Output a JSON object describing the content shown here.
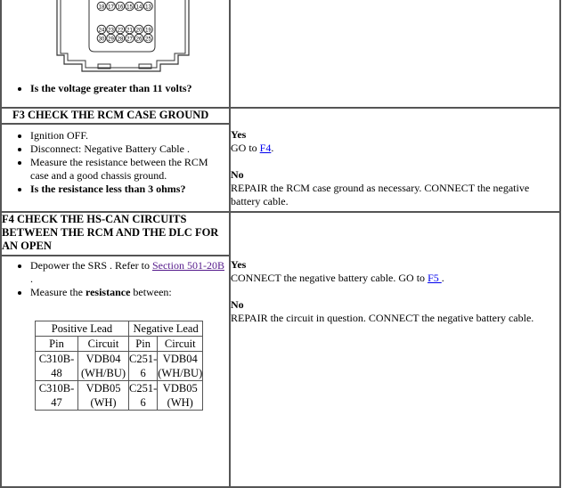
{
  "step_f2": {
    "question": "Is the voltage greater than 11 volts?",
    "pins_top": [
      "18",
      "17",
      "16",
      "15",
      "14",
      "13"
    ],
    "pins_mid": [
      "24",
      "23",
      "22",
      "21",
      "20",
      "19"
    ],
    "pins_bot": [
      "30",
      "29",
      "28",
      "27",
      "26",
      "25"
    ]
  },
  "step_f3": {
    "title": "F3 CHECK THE RCM CASE GROUND",
    "steps": [
      "Ignition OFF.",
      "Disconnect: Negative Battery Cable .",
      "Measure the resistance between the RCM case and a good chassis ground."
    ],
    "question": "Is the resistance less than 3 ohms?",
    "yes_label": "Yes",
    "yes_text": "GO to ",
    "yes_link": "F4",
    "yes_end": ".",
    "no_label": "No",
    "no_text": "REPAIR the RCM case ground as necessary. CONNECT the negative battery cable."
  },
  "step_f4": {
    "title": "F4 CHECK THE HS-CAN CIRCUITS BETWEEN THE RCM AND THE DLC FOR AN OPEN",
    "step1_text": "Depower the SRS . Refer to ",
    "step1_link": "Section 501-20B ",
    "step1_end": ".",
    "step2_text": "Measure the ",
    "step2_bold": "resistance",
    "step2_end": " between:",
    "table": {
      "group_headers": [
        "Positive Lead",
        "Negative Lead"
      ],
      "headers": [
        "Pin",
        "Circuit",
        "Pin",
        "Circuit"
      ],
      "rows": [
        [
          "C310B-48",
          "VDB04 (WH/BU)",
          "C251-6",
          "VDB04 (WH/BU)"
        ],
        [
          "C310B-47",
          "VDB05 (WH)",
          "C251-6",
          "VDB05 (WH)"
        ]
      ]
    },
    "yes_label": "Yes",
    "yes_text": "CONNECT the negative battery cable. GO to ",
    "yes_link": "F5 ",
    "yes_end": ".",
    "no_label": "No",
    "no_text": "REPAIR the circuit in question. CONNECT the negative battery cable."
  }
}
